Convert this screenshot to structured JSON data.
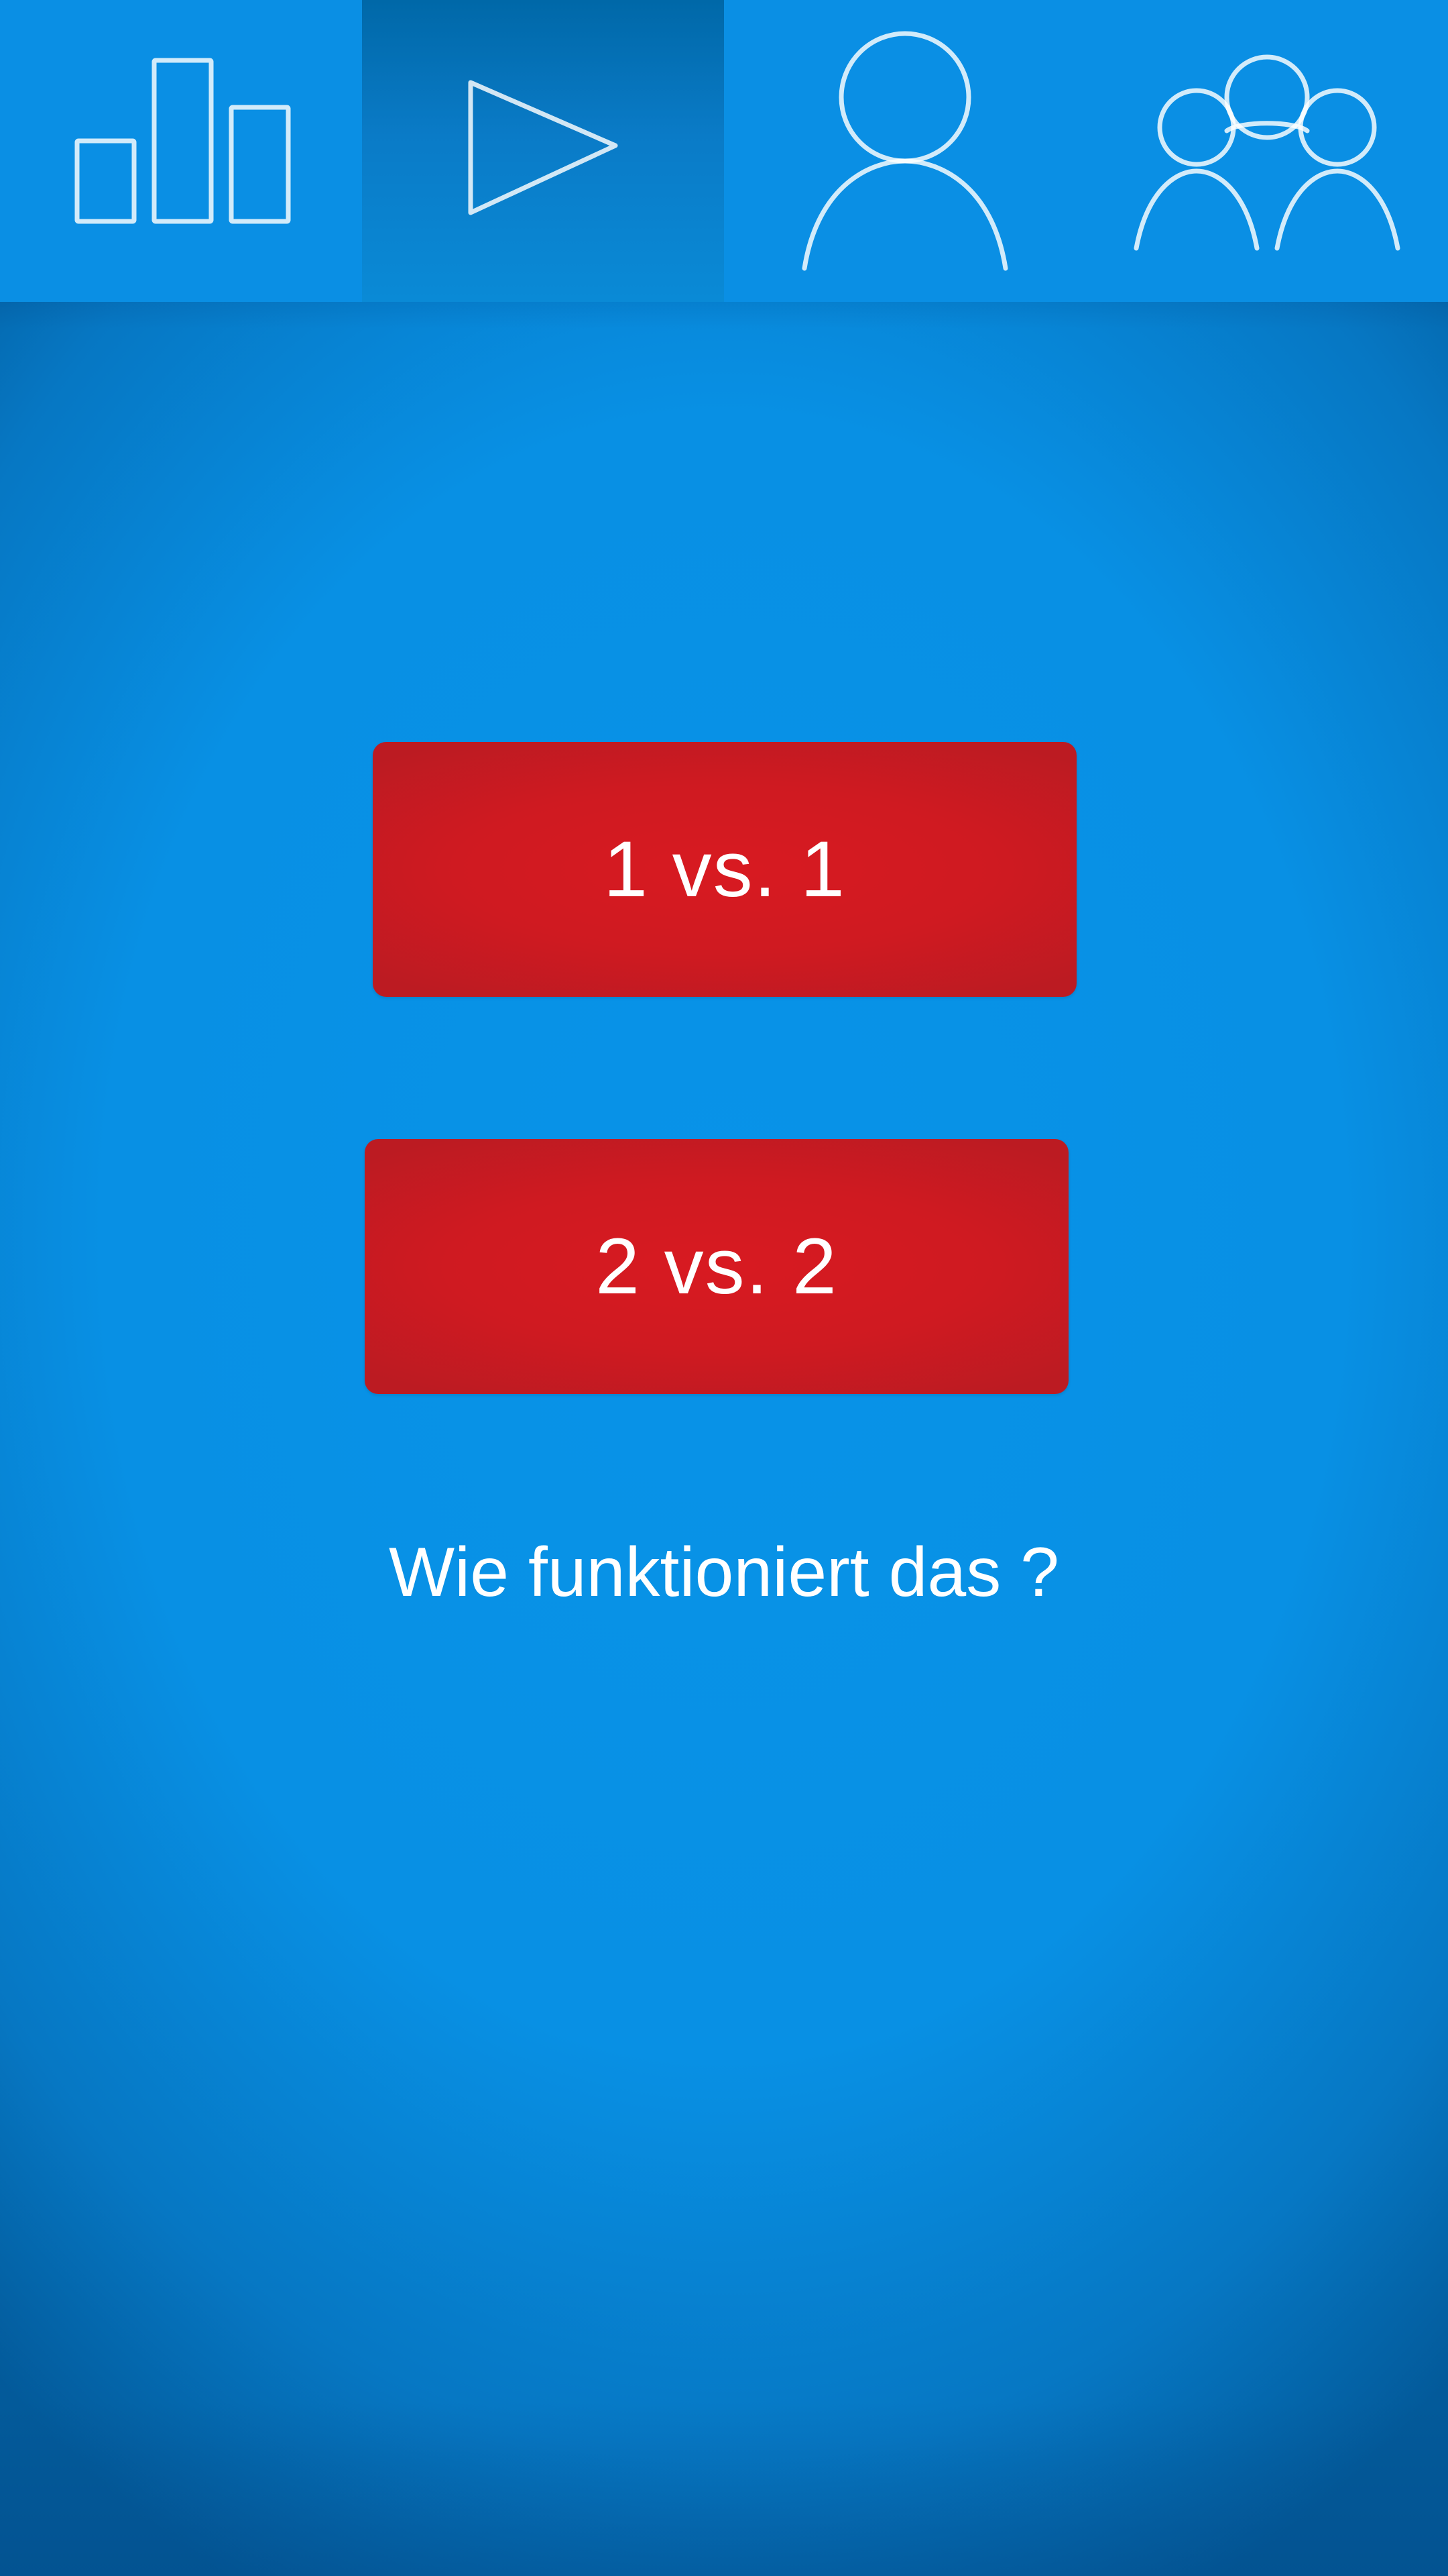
{
  "tabs": [
    {
      "id": "stats",
      "icon": "bar-chart-icon",
      "active": false
    },
    {
      "id": "play",
      "icon": "play-icon",
      "active": true
    },
    {
      "id": "profile",
      "icon": "user-icon",
      "active": false
    },
    {
      "id": "group",
      "icon": "group-icon",
      "active": false
    }
  ],
  "modes": {
    "one_vs_one_label": "1 vs. 1",
    "two_vs_two_label": "2 vs. 2"
  },
  "help": {
    "label": "Wie funktioniert das ?"
  },
  "colors": {
    "background": "#0a8fe4",
    "button_red": "#d01b22",
    "active_tab": "#0a7bc7",
    "text": "#ffffff"
  }
}
